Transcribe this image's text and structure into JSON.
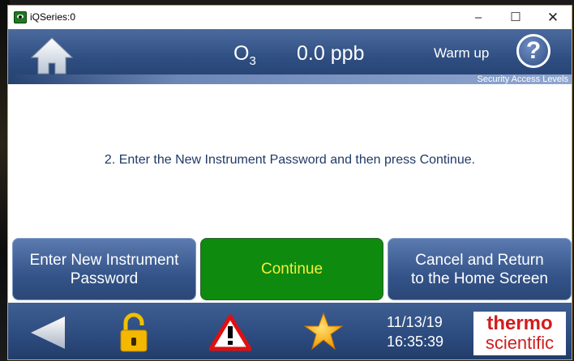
{
  "window": {
    "title": "iQSeries:0",
    "minimize_glyph": "–",
    "maximize_glyph": "☐",
    "close_glyph": "✕"
  },
  "header": {
    "gas_label": "O",
    "gas_subscript": "3",
    "concentration": "0.0 ppb",
    "status": "Warm up",
    "help_glyph": "?",
    "security_label": "Security Access Levels"
  },
  "content": {
    "instruction": "2. Enter the New Instrument Password and then press Continue."
  },
  "actions": {
    "enter_label_line1": "Enter New Instrument",
    "enter_label_line2": "Password",
    "continue_label": "Continue",
    "cancel_label_line1": "Cancel and Return",
    "cancel_label_line2": "to the Home Screen"
  },
  "footer": {
    "date": "11/13/19",
    "time": "16:35:39",
    "logo_top": "thermo",
    "logo_bottom": "scientific",
    "icons": [
      "back-arrow-icon",
      "unlocked-padlock-icon",
      "alarm-warning-icon",
      "favorite-star-icon"
    ]
  },
  "colors": {
    "header_blue": "#2e4d80",
    "continue_green": "#0e8a0e",
    "continue_text": "#f4ee3a",
    "instruction_text": "#1f3a66",
    "logo_red": "#d11d1d"
  }
}
